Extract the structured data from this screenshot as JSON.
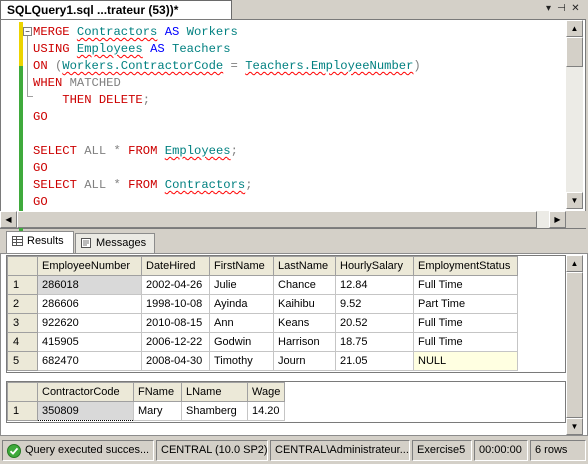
{
  "tab": {
    "title": "SQLQuery1.sql ...trateur (53))*"
  },
  "code": {
    "lines": [
      [
        "MERGE",
        "Contractors",
        "AS",
        "Workers"
      ],
      [
        "USING",
        "Employees",
        "AS",
        "Teachers"
      ],
      [
        "ON",
        "(",
        "Workers.ContractorCode",
        "=",
        "Teachers.EmployeeNumber",
        ")"
      ],
      [
        "WHEN",
        "MATCHED"
      ],
      [
        "THEN",
        "DELETE",
        ";"
      ],
      [
        "GO"
      ],
      [],
      [
        "SELECT",
        "ALL",
        "*",
        "FROM",
        "Employees",
        ";"
      ],
      [
        "GO"
      ],
      [
        "SELECT",
        "ALL",
        "*",
        "FROM",
        "Contractors",
        ";"
      ],
      [
        "GO"
      ]
    ]
  },
  "results_tabs": {
    "results": "Results",
    "messages": "Messages"
  },
  "grid1": {
    "headers": [
      "EmployeeNumber",
      "DateHired",
      "FirstName",
      "LastName",
      "HourlySalary",
      "EmploymentStatus"
    ],
    "rows": [
      [
        "1",
        "286018",
        "2002-04-26",
        "Julie",
        "Chance",
        "12.84",
        "Full Time"
      ],
      [
        "2",
        "286606",
        "1998-10-08",
        "Ayinda",
        "Kaihibu",
        "9.52",
        "Part Time"
      ],
      [
        "3",
        "922620",
        "2010-08-15",
        "Ann",
        "Keans",
        "20.52",
        "Full Time"
      ],
      [
        "4",
        "415905",
        "2006-12-22",
        "Godwin",
        "Harrison",
        "18.75",
        "Full Time"
      ],
      [
        "5",
        "682470",
        "2008-04-30",
        "Timothy",
        "Journ",
        "21.05",
        "NULL"
      ]
    ]
  },
  "grid2": {
    "headers": [
      "ContractorCode",
      "FName",
      "LName",
      "Wage"
    ],
    "rows": [
      [
        "1",
        "350809",
        "Mary",
        "Shamberg",
        "14.20"
      ]
    ]
  },
  "status": {
    "message": "Query executed succes...",
    "server": "CENTRAL (10.0 SP2)",
    "user": "CENTRAL\\Administrateur...",
    "database": "Exercise5",
    "time": "00:00:00",
    "rows": "6 rows"
  },
  "colors": {
    "keyword": "#0000ff",
    "dml": "#cc0000",
    "identifier": "#008080",
    "status_ok": "#3faa3c"
  }
}
